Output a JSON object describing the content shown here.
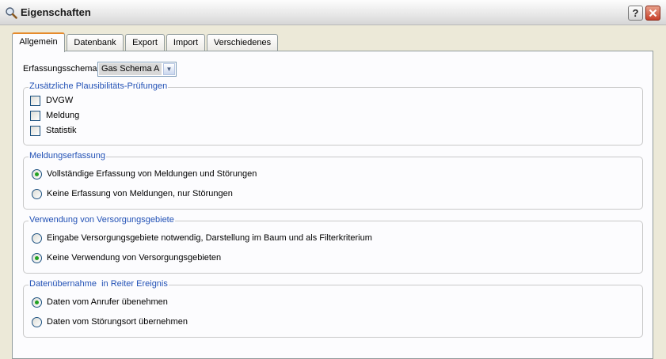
{
  "window": {
    "title": "Eigenschaften",
    "help_label": "?",
    "close_label": "✕",
    "icon": "magnifier-icon"
  },
  "tabs": [
    {
      "label": "Allgemein",
      "active": true
    },
    {
      "label": "Datenbank",
      "active": false
    },
    {
      "label": "Export",
      "active": false
    },
    {
      "label": "Import",
      "active": false
    },
    {
      "label": "Verschiedenes",
      "active": false
    }
  ],
  "schema": {
    "label": "Erfassungsschema",
    "value": "Gas Schema A",
    "arrow": "▼"
  },
  "plausibility": {
    "title": "Zusätzliche Plausibilitäts-Prüfungen",
    "items": [
      {
        "label": "DVGW",
        "checked": false
      },
      {
        "label": "Meldung",
        "checked": false
      },
      {
        "label": "Statistik",
        "checked": false
      }
    ]
  },
  "meldung": {
    "title": "Meldungserfassung",
    "options": [
      {
        "label": "Vollständige Erfassung von Meldungen und Störungen",
        "selected": true
      },
      {
        "label": "Keine Erfassung von Meldungen, nur Störungen",
        "selected": false
      }
    ]
  },
  "versorgung": {
    "title": "Verwendung von Versorgungsgebiete",
    "options": [
      {
        "label": "Eingabe Versorgungsgebiete notwendig, Darstellung im Baum und als Filterkriterium",
        "selected": false
      },
      {
        "label": "Keine Verwendung von Versorgungsgebieten",
        "selected": true
      }
    ]
  },
  "datenuebernahme": {
    "title": "Datenübernahme  in Reiter Ereignis",
    "options": [
      {
        "label": "Daten vom Anrufer übenehmen",
        "selected": true
      },
      {
        "label": "Daten vom Störungsort übernehmen",
        "selected": false
      }
    ]
  }
}
